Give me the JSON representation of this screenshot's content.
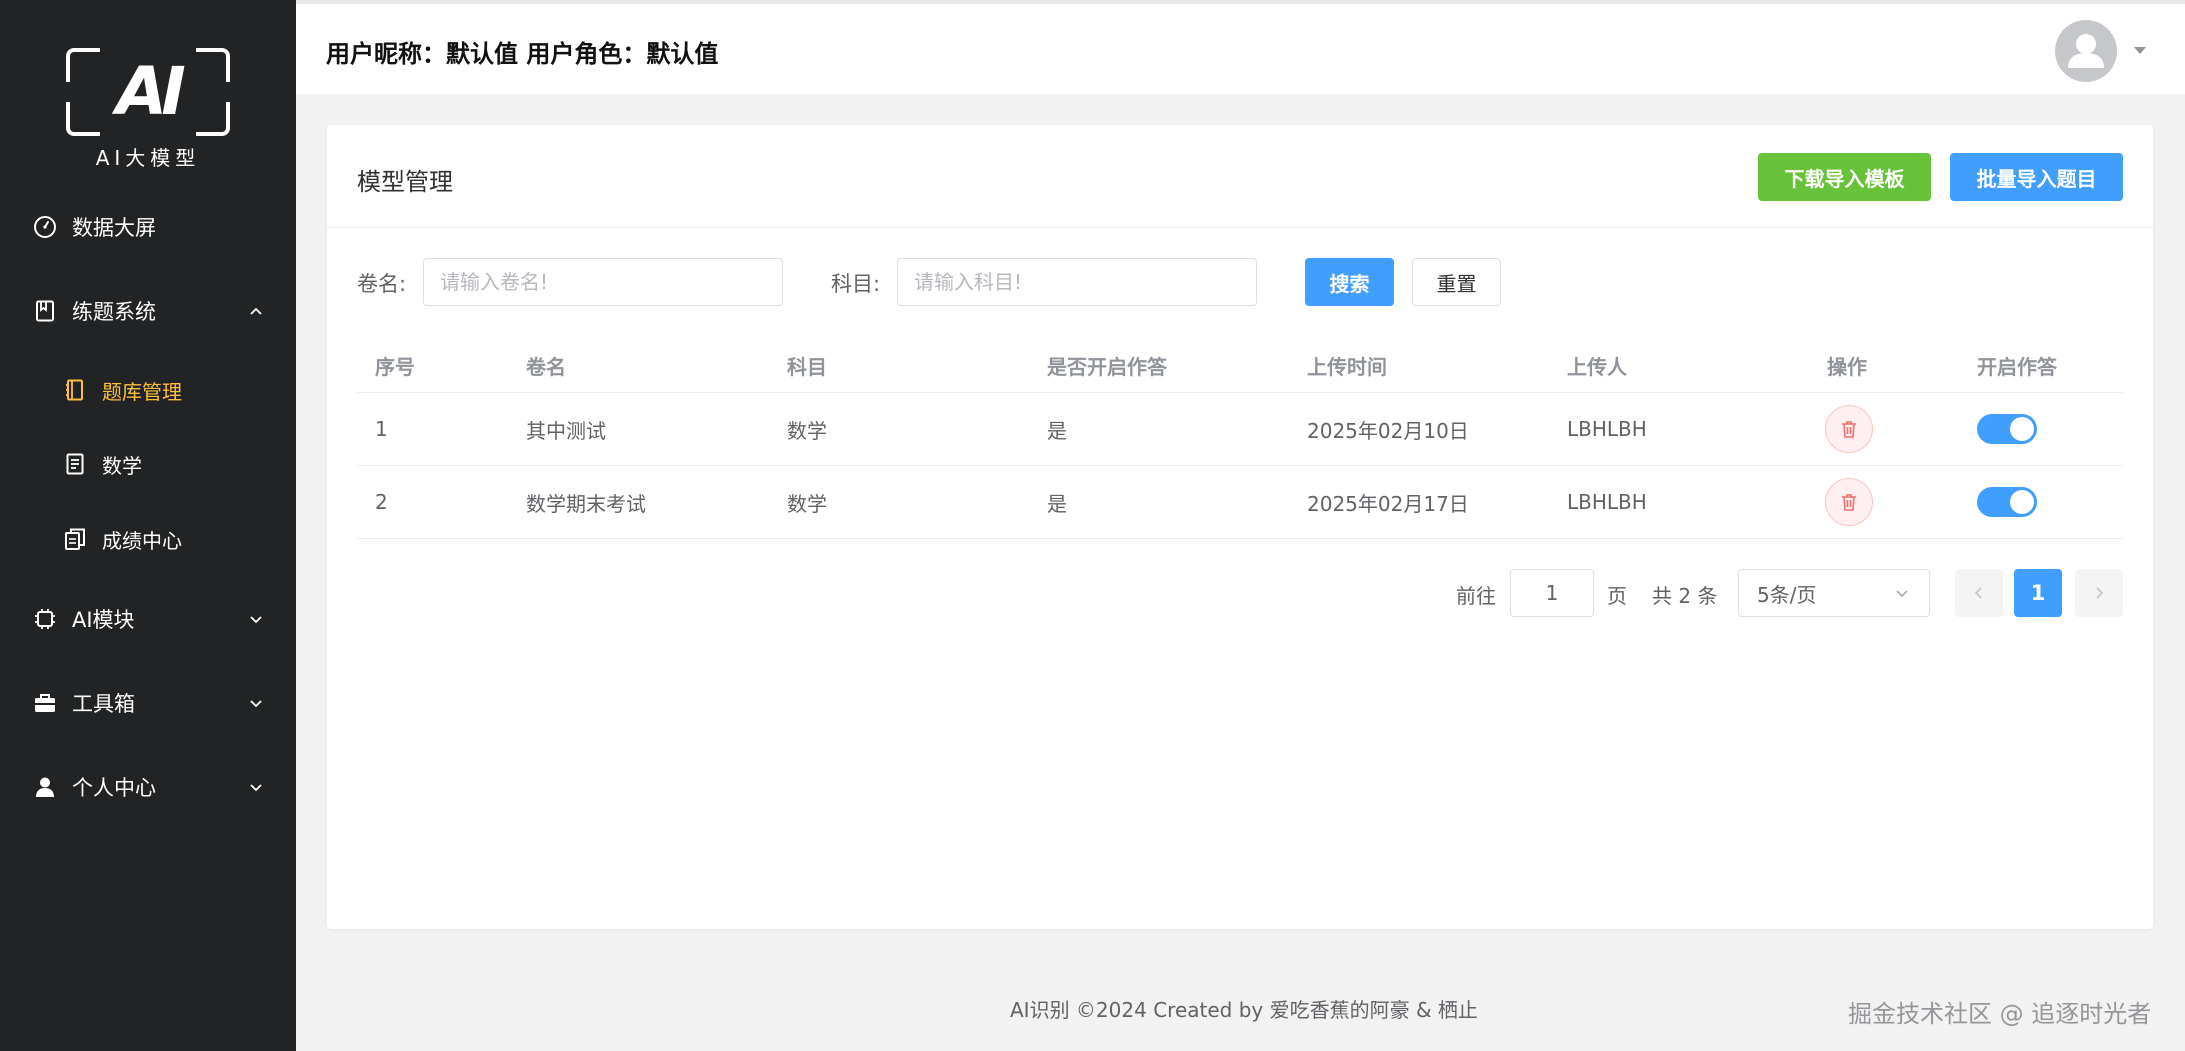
{
  "sidebar": {
    "logo_text": "AI大模型",
    "logo_mark": "AI",
    "items": {
      "dashboard": {
        "label": "数据大屏",
        "icon": "gauge-icon"
      },
      "practice": {
        "label": "练题系统",
        "icon": "book-icon",
        "expanded": true
      },
      "question_bank": {
        "label": "题库管理",
        "icon": "notebook-icon",
        "active": true
      },
      "math": {
        "label": "数学",
        "icon": "document-icon"
      },
      "scores": {
        "label": "成绩中心",
        "icon": "copy-document-icon"
      },
      "ai_module": {
        "label": "AI模块",
        "icon": "cpu-icon"
      },
      "toolbox": {
        "label": "工具箱",
        "icon": "briefcase-icon"
      },
      "profile": {
        "label": "个人中心",
        "icon": "user-icon"
      }
    }
  },
  "header": {
    "nickname_label": "用户昵称：",
    "nickname_value": "默认值",
    "role_label": "用户角色：",
    "role_value": "默认值"
  },
  "card": {
    "title": "模型管理",
    "download_template_label": "下载导入模板",
    "batch_import_label": "批量导入题目"
  },
  "search": {
    "name_label": "卷名:",
    "name_placeholder": "请输入卷名!",
    "name_value": "",
    "subject_label": "科目:",
    "subject_placeholder": "请输入科目!",
    "subject_value": "",
    "search_label": "搜索",
    "reset_label": "重置"
  },
  "table": {
    "columns": [
      "序号",
      "卷名",
      "科目",
      "是否开启作答",
      "上传时间",
      "上传人",
      "操作",
      "开启作答"
    ],
    "rows": [
      {
        "index": "1",
        "name": "其中测试",
        "subject": "数学",
        "open": "是",
        "time": "2025年02月10日",
        "uploader": "LBHLBH",
        "enabled": true
      },
      {
        "index": "2",
        "name": "数学期末考试",
        "subject": "数学",
        "open": "是",
        "time": "2025年02月17日",
        "uploader": "LBHLBH",
        "enabled": true
      }
    ]
  },
  "pagination": {
    "goto_label": "前往",
    "goto_value": "1",
    "page_label": "页",
    "total_label": "共 2 条",
    "page_size": "5条/页",
    "current_page": "1"
  },
  "footer": {
    "text": "AI识别 ©2024 Created by 爱吃香蕉的阿豪 & 栖止",
    "watermark": "掘金技术社区 @ 追逐时光者"
  },
  "colors": {
    "sidebar_bg": "#222324",
    "active_menu": "#ffbf3f",
    "primary": "#409eff",
    "success": "#67c23a",
    "danger": "#f56c6c"
  }
}
